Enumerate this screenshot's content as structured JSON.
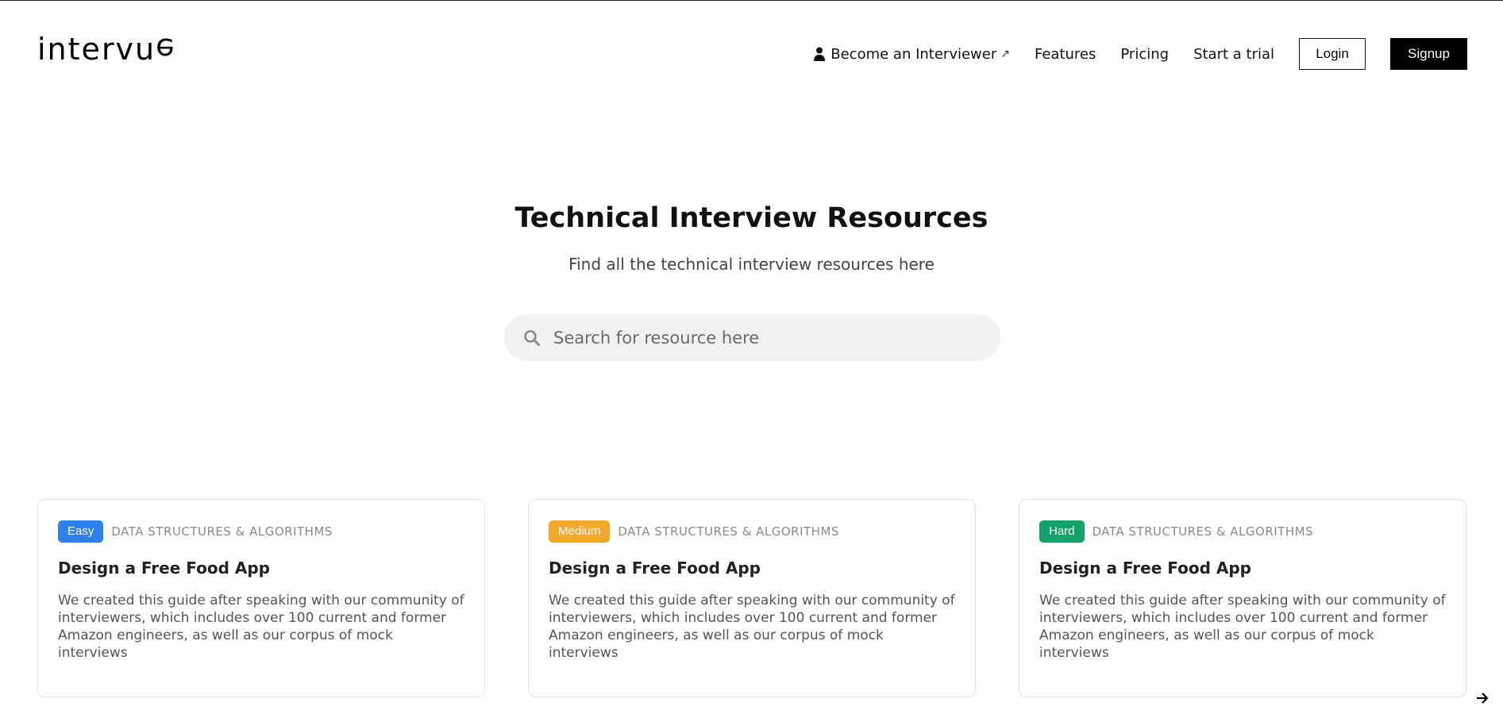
{
  "brand": {
    "logo_text_a": "int",
    "logo_text_b": "e",
    "logo_text_c": "rvu",
    "logo_text_d": "e"
  },
  "nav": {
    "become_interviewer": "Become an Interviewer",
    "external_arrow": "↗",
    "features": "Features",
    "pricing": "Pricing",
    "start_trial": "Start a trial",
    "login": "Login",
    "signup": "Signup"
  },
  "hero": {
    "title": "Technical Interview Resources",
    "subtitle": "Find all the technical interview resources here"
  },
  "search": {
    "placeholder": "Search for resource here",
    "value": ""
  },
  "cards": [
    {
      "difficulty": "Easy",
      "difficulty_color": "#2f80ed",
      "category": "DATA STRUCTURES & ALGORITHMS",
      "title": "Design a Free Food App",
      "description": "We created this guide after speaking with our community of interviewers, which includes over 100 current and former Amazon engineers, as well as our corpus of mock interviews"
    },
    {
      "difficulty": "Medium",
      "difficulty_color": "#f2a828",
      "category": "DATA STRUCTURES & ALGORITHMS",
      "title": "Design a Free Food App",
      "description": "We created this guide after speaking with our community of interviewers, which includes over 100 current and former Amazon engineers, as well as our corpus of mock interviews"
    },
    {
      "difficulty": "Hard",
      "difficulty_color": "#12a36a",
      "category": "DATA STRUCTURES & ALGORITHMS",
      "title": "Design a Free Food App",
      "description": "We created this guide after speaking with our community of interviewers, which includes over 100 current and former Amazon engineers, as well as our corpus of mock interviews"
    }
  ],
  "icons": {
    "person": "person-icon",
    "search": "search-icon",
    "next_arrow": "arrow-right-icon"
  }
}
